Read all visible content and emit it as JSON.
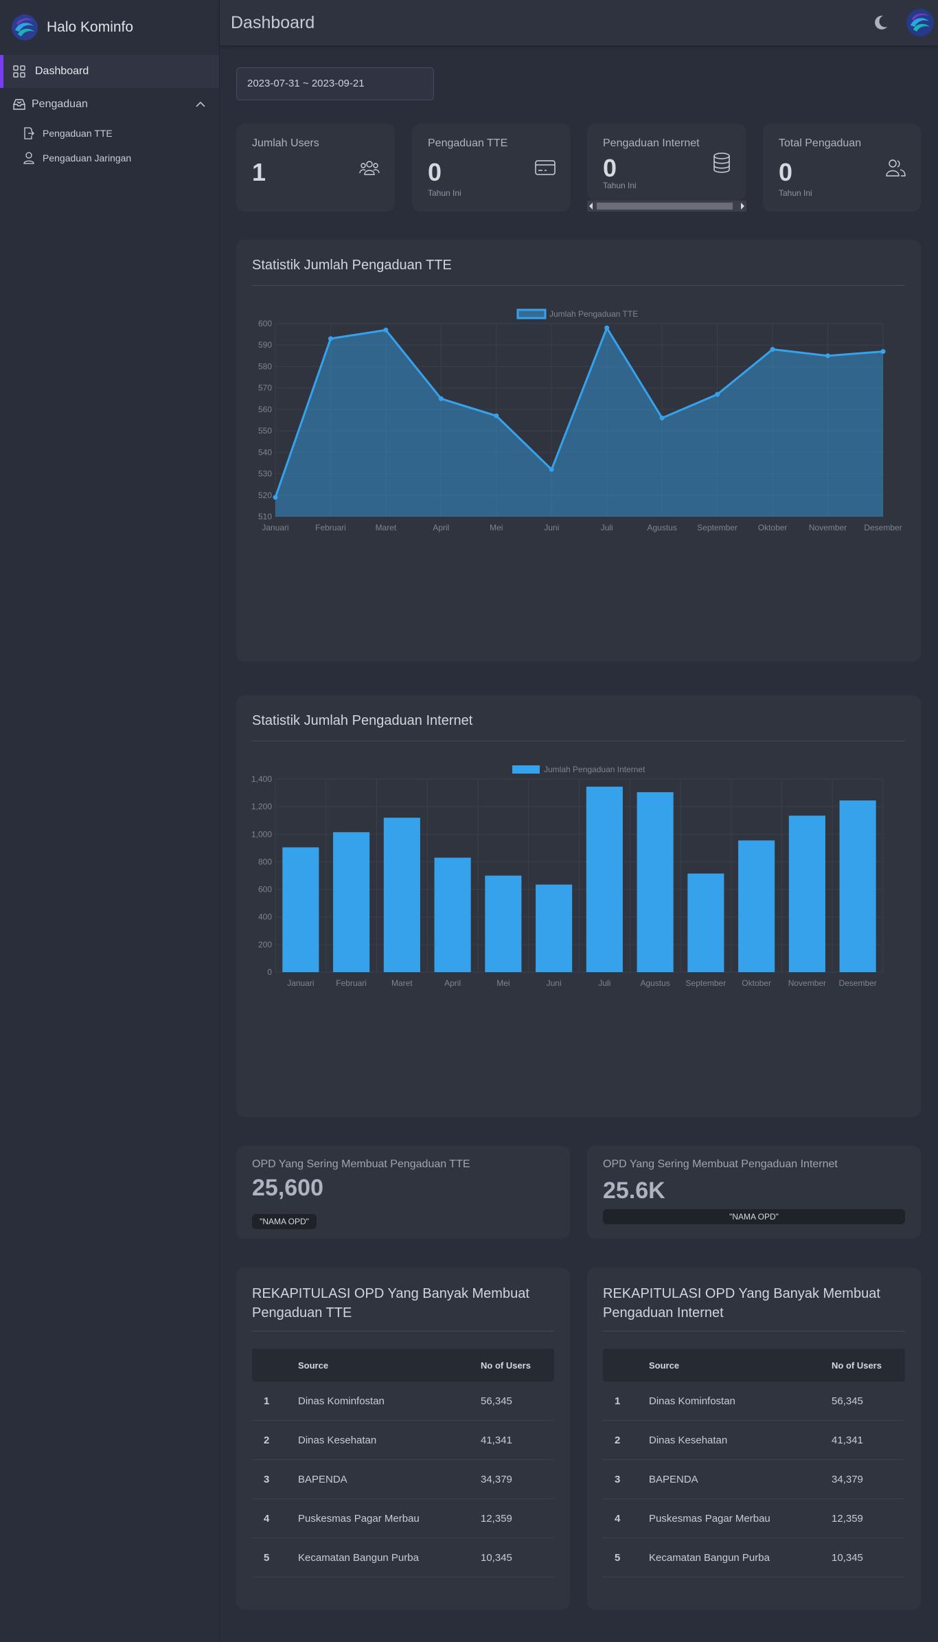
{
  "brand": {
    "name": "Halo Kominfo"
  },
  "sidebar": {
    "items": [
      {
        "label": "Dashboard"
      },
      {
        "label": "Pengaduan"
      },
      {
        "label": "Pengaduan TTE"
      },
      {
        "label": "Pengaduan Jaringan"
      }
    ]
  },
  "header": {
    "title": "Dashboard"
  },
  "date_range": "2023-07-31 ~ 2023-09-21",
  "stats": [
    {
      "title": "Jumlah Users",
      "value": "1",
      "sub": "",
      "icon": "users-icon"
    },
    {
      "title": "Pengaduan TTE",
      "value": "0",
      "sub": "Tahun Ini",
      "icon": "credit-card-icon"
    },
    {
      "title": "Pengaduan Internet",
      "value": "0",
      "sub": "Tahun Ini",
      "icon": "database-icon"
    },
    {
      "title": "Total Pengaduan",
      "value": "0",
      "sub": "Tahun Ini",
      "icon": "user-group-icon"
    }
  ],
  "chart_tte_title": "Statistik Jumlah Pengaduan TTE",
  "chart_internet_title": "Statistik Jumlah Pengaduan Internet",
  "chart_data": [
    {
      "type": "area",
      "title": "Statistik Jumlah Pengaduan TTE",
      "categories": [
        "Januari",
        "Februari",
        "Maret",
        "April",
        "Mei",
        "Juni",
        "Juli",
        "Agustus",
        "September",
        "Oktober",
        "November",
        "Desember"
      ],
      "series": [
        {
          "name": "Jumlah Pengaduan TTE",
          "values": [
            519,
            593,
            597,
            565,
            557,
            532,
            598,
            556,
            567,
            588,
            585,
            587
          ]
        }
      ],
      "ylim": [
        510,
        600
      ],
      "yticks": [
        "510",
        "520",
        "530",
        "540",
        "550",
        "560",
        "570",
        "580",
        "590",
        "600"
      ],
      "grid": true,
      "legend": "top",
      "color": "#36a2eb"
    },
    {
      "type": "bar",
      "title": "Statistik Jumlah Pengaduan Internet",
      "categories": [
        "Januari",
        "Februari",
        "Maret",
        "April",
        "Mei",
        "Juni",
        "Juli",
        "Agustus",
        "September",
        "Oktober",
        "November",
        "Desember"
      ],
      "series": [
        {
          "name": "Jumlah Pengaduan Internet",
          "values": [
            905,
            1015,
            1120,
            830,
            700,
            635,
            1345,
            1305,
            715,
            955,
            1135,
            1245
          ]
        }
      ],
      "ylim": [
        0,
        1400
      ],
      "yticks": [
        "0",
        "200",
        "400",
        "600",
        "800",
        "1,000",
        "1,200",
        "1,400"
      ],
      "grid": true,
      "legend": "top",
      "color": "#36a2eb"
    }
  ],
  "opd": [
    {
      "title": "OPD Yang Sering Membuat Pengaduan TTE",
      "value": "25,600",
      "badge": "\"NAMA OPD\""
    },
    {
      "title": "OPD Yang Sering Membuat Pengaduan Internet",
      "value": "25.6K",
      "badge": "\"NAMA OPD\""
    }
  ],
  "tables": [
    {
      "title": "REKAPITULASI OPD Yang Banyak Membuat Pengaduan TTE",
      "columns": [
        "Source",
        "No of Users"
      ],
      "rows": [
        [
          "1",
          "Dinas Kominfostan",
          "56,345"
        ],
        [
          "2",
          "Dinas Kesehatan",
          "41,341"
        ],
        [
          "3",
          "BAPENDA",
          "34,379"
        ],
        [
          "4",
          "Puskesmas Pagar Merbau",
          "12,359"
        ],
        [
          "5",
          "Kecamatan Bangun Purba",
          "10,345"
        ]
      ]
    },
    {
      "title": "REKAPITULASI OPD Yang Banyak Membuat Pengaduan Internet",
      "columns": [
        "Source",
        "No of Users"
      ],
      "rows": [
        [
          "1",
          "Dinas Kominfostan",
          "56,345"
        ],
        [
          "2",
          "Dinas Kesehatan",
          "41,341"
        ],
        [
          "3",
          "BAPENDA",
          "34,379"
        ],
        [
          "4",
          "Puskesmas Pagar Merbau",
          "12,359"
        ],
        [
          "5",
          "Kecamatan Bangun Purba",
          "10,345"
        ]
      ]
    }
  ]
}
